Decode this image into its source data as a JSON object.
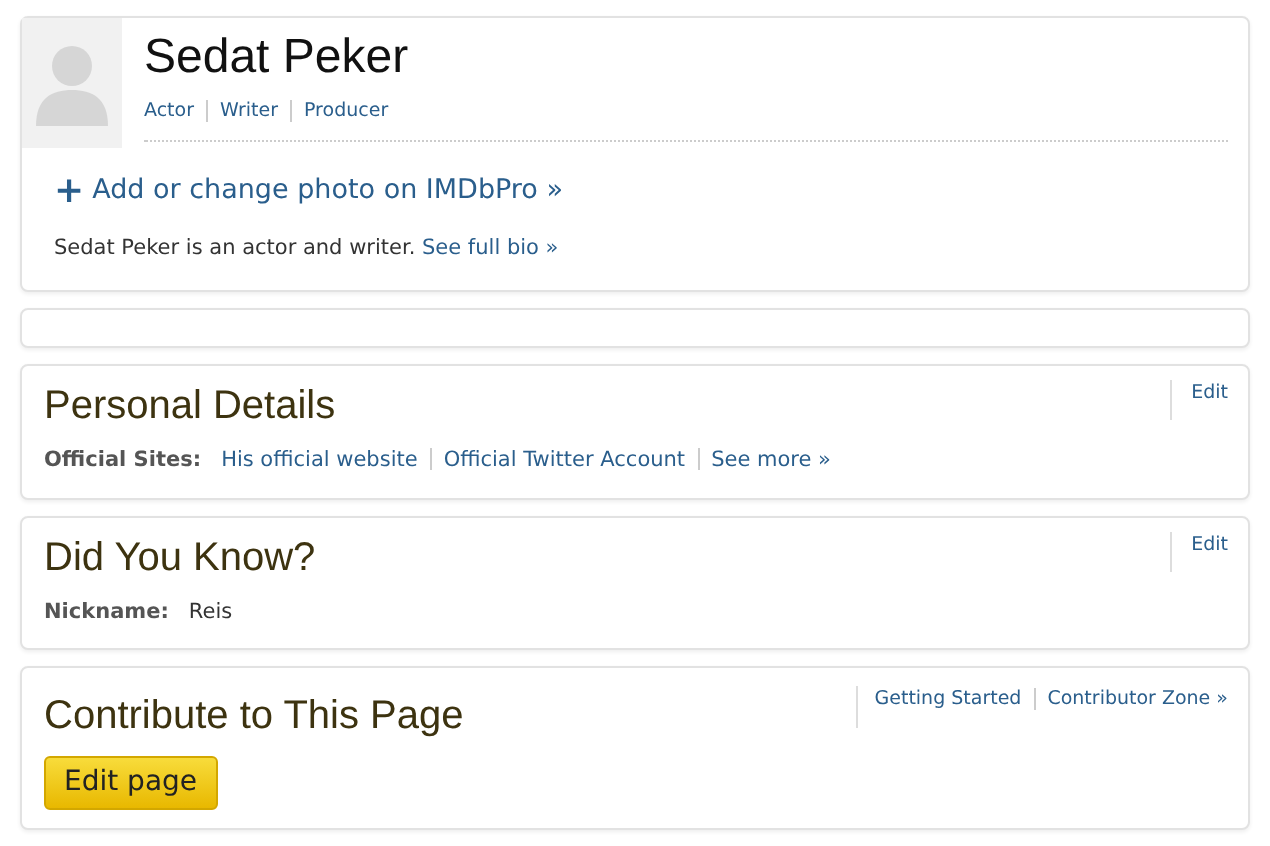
{
  "profile": {
    "name": "Sedat Peker",
    "roles": [
      "Actor",
      "Writer",
      "Producer"
    ],
    "photo_link": {
      "icon": "+",
      "label": "Add or change photo on IMDbPro »"
    },
    "bio": "Sedat Peker is an actor and writer.",
    "bio_link": "See full bio »"
  },
  "sections": [
    {
      "kind": "empty"
    },
    {
      "kind": "details",
      "title": "Personal Details",
      "edit": "Edit",
      "label": "Official Sites:",
      "links": [
        "His official website",
        "Official Twitter Account",
        "See more »"
      ]
    },
    {
      "kind": "details",
      "title": "Did You Know?",
      "edit": "Edit",
      "label": "Nickname:",
      "value": "Reis"
    },
    {
      "kind": "contribute",
      "title": "Contribute to This Page",
      "links": [
        "Getting Started",
        "Contributor Zone »"
      ],
      "button": "Edit page"
    }
  ]
}
